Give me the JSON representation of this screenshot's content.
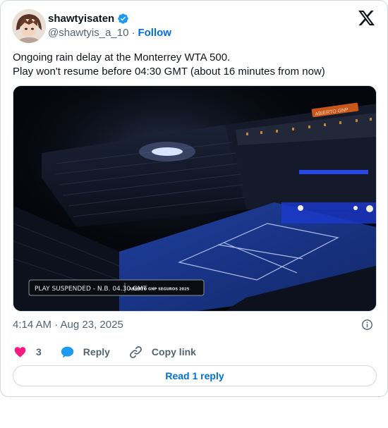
{
  "author": {
    "display_name": "shawtyisaten",
    "handle": "@shawtyis_a_10",
    "separator": "·",
    "follow_label": "Follow"
  },
  "tweet": {
    "line1": "Ongoing rain delay at the Monterrey WTA 500.",
    "line2": "Play won't resume before 04:30 GMT (about 16 minutes from now)"
  },
  "media": {
    "caption_left": "PLAY SUSPENDED - N.B. 04.30 GMT",
    "caption_right": "ABIERTO GNP SEGUROS 2025",
    "stadium_sign": "ABIERTO GNP"
  },
  "meta": {
    "timestamp": "4:14 AM · Aug 23, 2025"
  },
  "actions": {
    "like_count": "3",
    "reply_label": "Reply",
    "copy_link_label": "Copy link"
  },
  "read_reply_label": "Read 1 reply",
  "colors": {
    "like": "#f91880",
    "reply": "#1d9bf0",
    "link": "#006fd6",
    "verified": "#1d9bf0"
  }
}
